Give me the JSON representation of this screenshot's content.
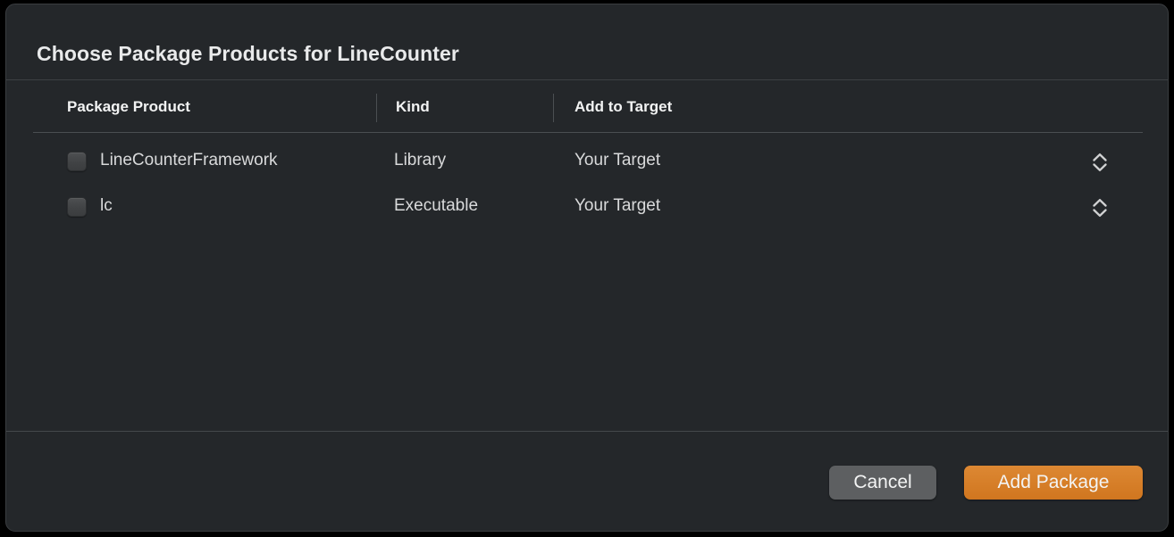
{
  "dialog": {
    "title": "Choose Package Products for LineCounter",
    "accent_color": "#d0761f",
    "background_color": "#24272a"
  },
  "table": {
    "columns": [
      {
        "label": "Package Product"
      },
      {
        "label": "Kind"
      },
      {
        "label": "Add to Target"
      }
    ],
    "rows": [
      {
        "checked": false,
        "product": "LineCounterFramework",
        "kind": "Library",
        "target": "Your Target",
        "stepper_icon": "stepper-updown-icon"
      },
      {
        "checked": false,
        "product": "lc",
        "kind": "Executable",
        "target": "Your Target",
        "stepper_icon": "stepper-updown-icon"
      }
    ]
  },
  "footer": {
    "cancel_label": "Cancel",
    "add_label": "Add Package"
  }
}
